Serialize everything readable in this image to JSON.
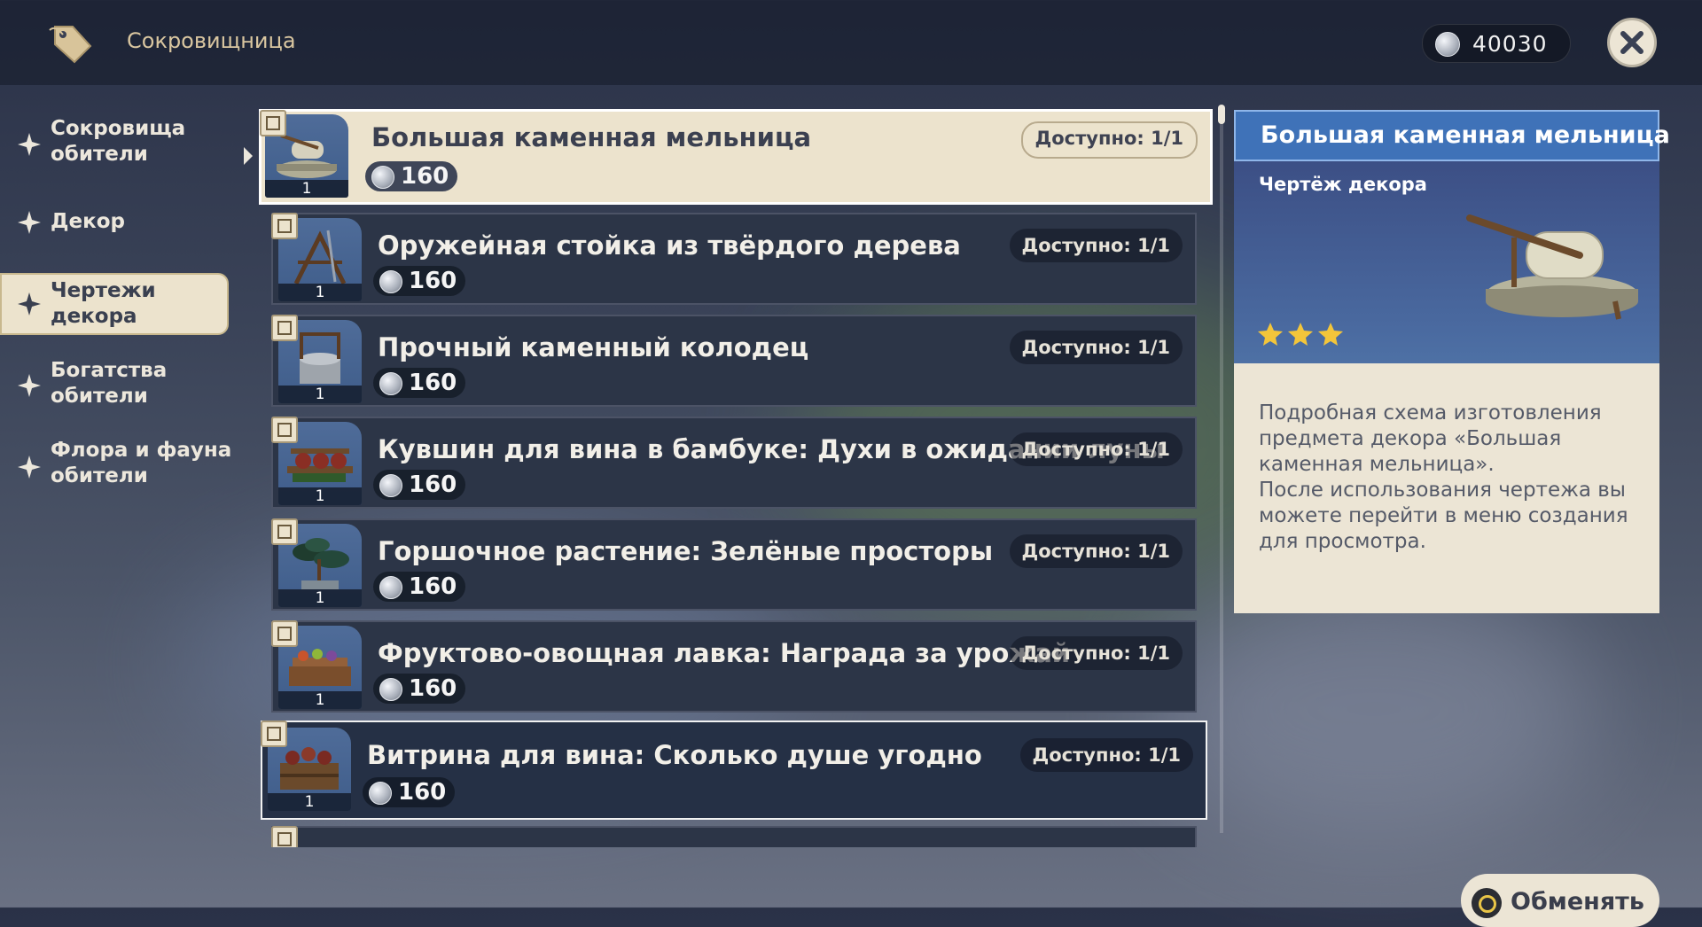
{
  "header": {
    "title": "Сокровищница",
    "currency": "40030"
  },
  "sidebar": {
    "items": [
      {
        "label": "Сокровища\nобители",
        "active": false
      },
      {
        "label": "Декор",
        "active": false
      },
      {
        "label": "Чертежи\nдекора",
        "active": true
      },
      {
        "label": "Богатства\nобители",
        "active": false
      },
      {
        "label": "Флора и фауна\nобители",
        "active": false
      }
    ]
  },
  "list": {
    "items": [
      {
        "name": "Большая каменная мельница",
        "price": "160",
        "available": "Доступно: 1/1",
        "count": "1",
        "state": "selected"
      },
      {
        "name": "Оружейная стойка из твёрдого дерева",
        "price": "160",
        "available": "Доступно: 1/1",
        "count": "1",
        "state": "normal"
      },
      {
        "name": "Прочный каменный колодец",
        "price": "160",
        "available": "Доступно: 1/1",
        "count": "1",
        "state": "normal"
      },
      {
        "name": "Кувшин для вина в бамбуке: Духи в ожидании луны",
        "price": "160",
        "available": "Доступно: 1/1",
        "count": "1",
        "state": "normal"
      },
      {
        "name": "Горшочное растение: Зелёные просторы",
        "price": "160",
        "available": "Доступно: 1/1",
        "count": "1",
        "state": "normal"
      },
      {
        "name": "Фруктово-овощная лавка: Награда за урожай",
        "price": "160",
        "available": "Доступно: 1/1",
        "count": "1",
        "state": "normal"
      },
      {
        "name": "Витрина для вина: Сколько душе угодно",
        "price": "160",
        "available": "Доступно: 1/1",
        "count": "1",
        "state": "highlighted"
      }
    ]
  },
  "detail": {
    "title": "Большая каменная мельница",
    "type": "Чертёж декора",
    "stars": 3,
    "description": "Подробная схема изготовления предмета декора «Большая каменная мельница».\nПосле использования чертежа вы можете перейти в меню создания для просмотра."
  },
  "actions": {
    "exchange_label": "Обменять"
  },
  "colors": {
    "accent": "#3f72b8",
    "parchment": "#ece3cd",
    "gold_text": "#d9c6a0",
    "star": "#f3c53a"
  }
}
